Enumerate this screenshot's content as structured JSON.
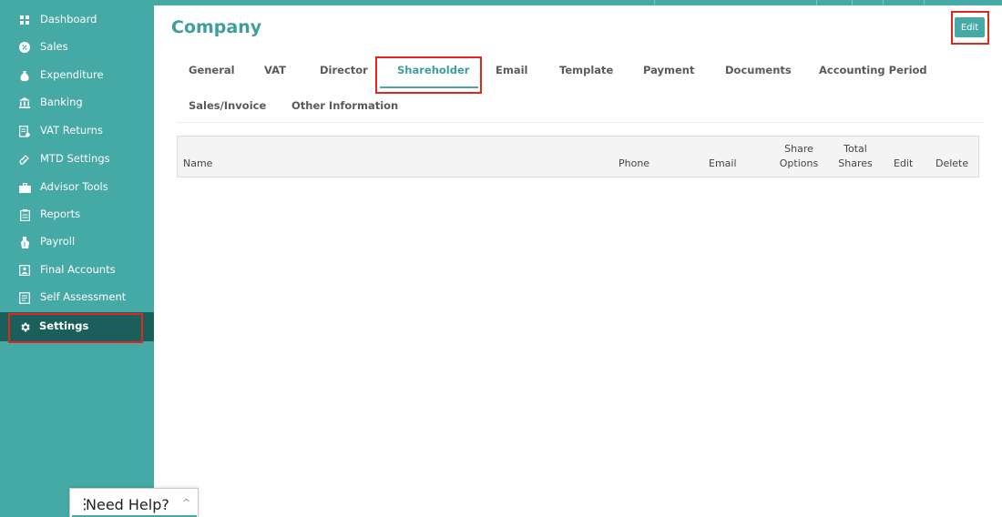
{
  "sidebar": {
    "items": [
      {
        "label": "Dashboard",
        "icon": "dashboard-icon"
      },
      {
        "label": "Sales",
        "icon": "sales-icon"
      },
      {
        "label": "Expenditure",
        "icon": "money-bag-icon"
      },
      {
        "label": "Banking",
        "icon": "bank-icon"
      },
      {
        "label": "VAT Returns",
        "icon": "vat-icon"
      },
      {
        "label": "MTD Settings",
        "icon": "mtd-icon"
      },
      {
        "label": "Advisor Tools",
        "icon": "briefcase-icon"
      },
      {
        "label": "Reports",
        "icon": "reports-icon"
      },
      {
        "label": "Payroll",
        "icon": "payroll-icon"
      },
      {
        "label": "Final Accounts",
        "icon": "final-accounts-icon"
      },
      {
        "label": "Self Assessment",
        "icon": "self-assessment-icon"
      },
      {
        "label": "Settings",
        "icon": "gear-icon",
        "active": true
      }
    ]
  },
  "main": {
    "title": "Company",
    "edit_label": "Edit",
    "tabs": [
      {
        "label": "General"
      },
      {
        "label": "VAT"
      },
      {
        "label": "Director"
      },
      {
        "label": "Shareholder",
        "active": true
      },
      {
        "label": "Email"
      },
      {
        "label": "Template"
      },
      {
        "label": "Payment"
      },
      {
        "label": "Documents"
      },
      {
        "label": "Accounting Period"
      },
      {
        "label": "Sales/Invoice"
      },
      {
        "label": "Other Information"
      }
    ],
    "table": {
      "columns": {
        "name": "Name",
        "phone": "Phone",
        "email": "Email",
        "share_options_1": "Share",
        "share_options_2": "Options",
        "total_shares_1": "Total",
        "total_shares_2": "Shares",
        "edit": "Edit",
        "delete": "Delete"
      }
    }
  },
  "help": {
    "label": "Need Help?",
    "chevron": "^"
  },
  "colors": {
    "sidebar": "#45a9a5",
    "sidebar_active": "#1b5f5d",
    "accent": "#3e9e9a",
    "highlight": "#e0281c"
  }
}
